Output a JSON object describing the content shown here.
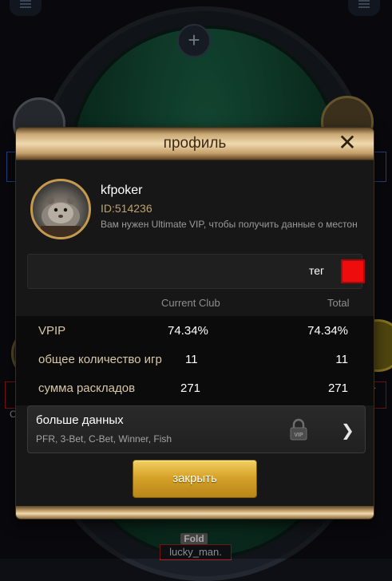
{
  "dialog": {
    "title": "профиль",
    "close_symbol": "✕"
  },
  "profile": {
    "username": "kfpoker",
    "id_text": "ID:514236",
    "vip_note": "Вам нужен Ultimate VIP, чтобы получить данные о местон",
    "avatar_icon": "hamster-avatar"
  },
  "tag": {
    "label": "тег",
    "color": "#ee0c0c"
  },
  "stats": {
    "columns": {
      "club": "Current Club",
      "total": "Total"
    },
    "rows": [
      {
        "label": "VPIP",
        "club": "74.34%",
        "total": "74.34%"
      },
      {
        "label": "общее количество игр",
        "club": "11",
        "total": "11"
      },
      {
        "label": "сумма раскладов",
        "club": "271",
        "total": "271"
      }
    ]
  },
  "more_data": {
    "title": "больше данных",
    "subtitle": "PFR, 3-Bet, C-Bet, Winner, Fish",
    "lock_icon": "vip-lock-icon",
    "chevron_icon": "chevron-right-icon"
  },
  "close_button": {
    "label": "закрыть"
  },
  "table": {
    "fold_label": "Fold",
    "player_name": "lucky_man.",
    "left_side_letter": "C",
    "right_side_text": "M."
  },
  "colors": {
    "gold": "#c69a4e",
    "felt": "#1f6e4e",
    "button_gold": "#d6a32a"
  }
}
